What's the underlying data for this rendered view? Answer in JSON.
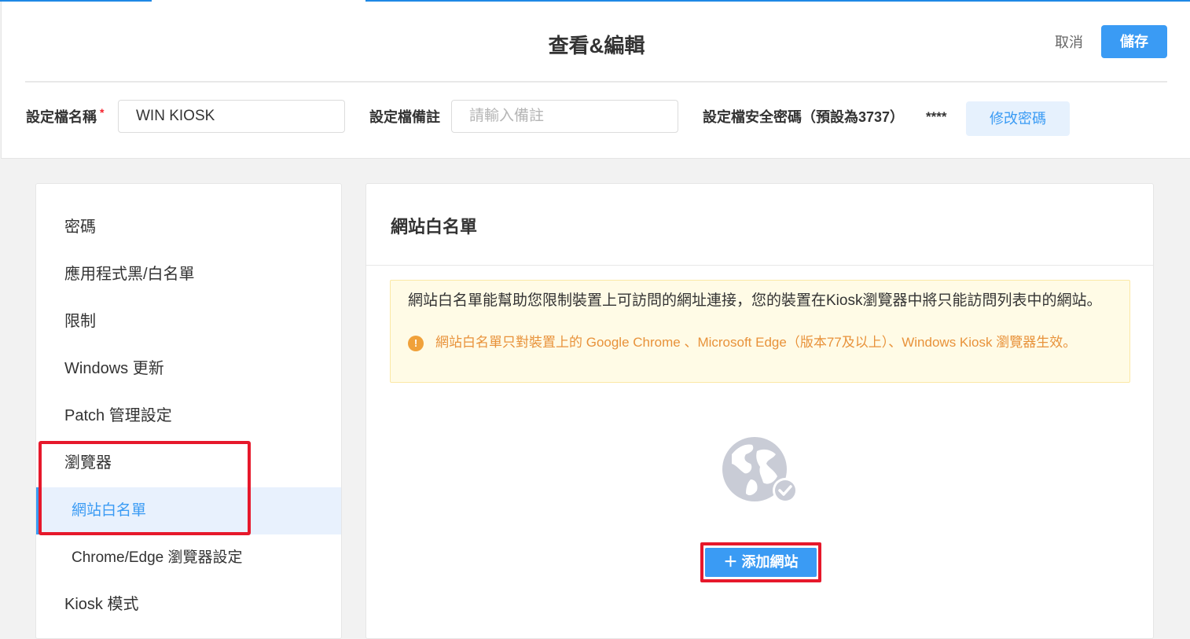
{
  "header": {
    "title": "查看&編輯",
    "cancel_label": "取消",
    "save_label": "儲存"
  },
  "form": {
    "name_label": "設定檔名稱",
    "name_required": "*",
    "name_value": "WIN KIOSK",
    "note_label": "設定檔備註",
    "note_placeholder": "請輸入備註",
    "password_label": "設定檔安全密碼（預設為3737）",
    "password_mask": "****",
    "change_password_label": "修改密碼"
  },
  "sidebar": {
    "items": [
      {
        "label": "密碼"
      },
      {
        "label": "應用程式黑/白名單"
      },
      {
        "label": "限制"
      },
      {
        "label": "Windows 更新"
      },
      {
        "label": "Patch 管理設定"
      },
      {
        "label": "瀏覽器"
      },
      {
        "label": "網站白名單",
        "active": true
      },
      {
        "label": "Chrome/Edge 瀏覽器設定"
      },
      {
        "label": "Kiosk 模式"
      }
    ]
  },
  "main": {
    "section_title": "網站白名單",
    "notice_text": "網站白名單能幫助您限制裝置上可訪問的網址連接，您的裝置在Kiosk瀏覽器中將只能訪問列表中的網站。",
    "warning_icon": "!",
    "warning_text": "網站白名單只對裝置上的 Google Chrome 、Microsoft Edge（版本77及以上）、Windows Kiosk 瀏覽器生效。",
    "empty_icon": "globe-check-icon",
    "add_site_label": "＋ 添加網站"
  },
  "colors": {
    "accent": "#3a9bf4",
    "highlight": "#e6182b",
    "warning": "#e8923a"
  }
}
